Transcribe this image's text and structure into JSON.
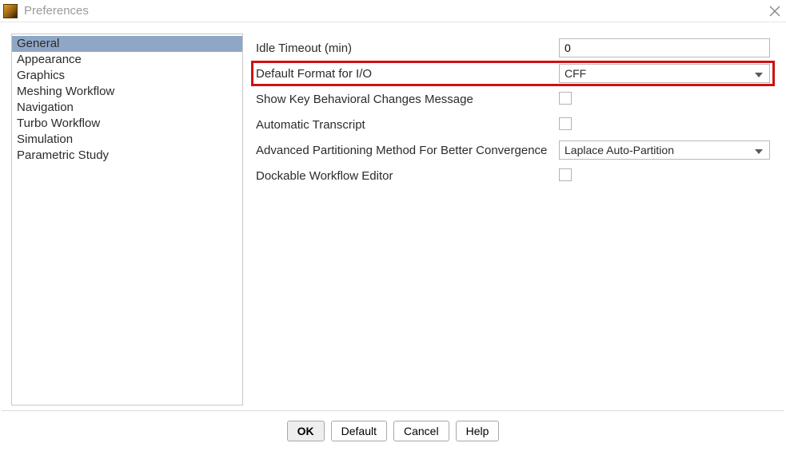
{
  "window": {
    "title": "Preferences"
  },
  "sidebar": {
    "items": [
      {
        "label": "General",
        "selected": true
      },
      {
        "label": "Appearance"
      },
      {
        "label": "Graphics"
      },
      {
        "label": "Meshing Workflow"
      },
      {
        "label": "Navigation"
      },
      {
        "label": "Turbo Workflow"
      },
      {
        "label": "Simulation"
      },
      {
        "label": "Parametric Study"
      }
    ]
  },
  "form": {
    "idle_timeout": {
      "label": "Idle Timeout (min)",
      "value": "0"
    },
    "default_format": {
      "label": "Default Format for I/O",
      "value": "CFF",
      "highlighted": true
    },
    "key_behavioral": {
      "label": "Show Key Behavioral Changes Message",
      "checked": false
    },
    "auto_transcript": {
      "label": "Automatic Transcript",
      "checked": false
    },
    "advanced_partition": {
      "label": "Advanced Partitioning Method For Better Convergence",
      "value": "Laplace Auto-Partition"
    },
    "dockable_workflow": {
      "label": "Dockable Workflow Editor",
      "checked": false
    }
  },
  "buttons": {
    "ok": "OK",
    "default": "Default",
    "cancel": "Cancel",
    "help": "Help"
  }
}
